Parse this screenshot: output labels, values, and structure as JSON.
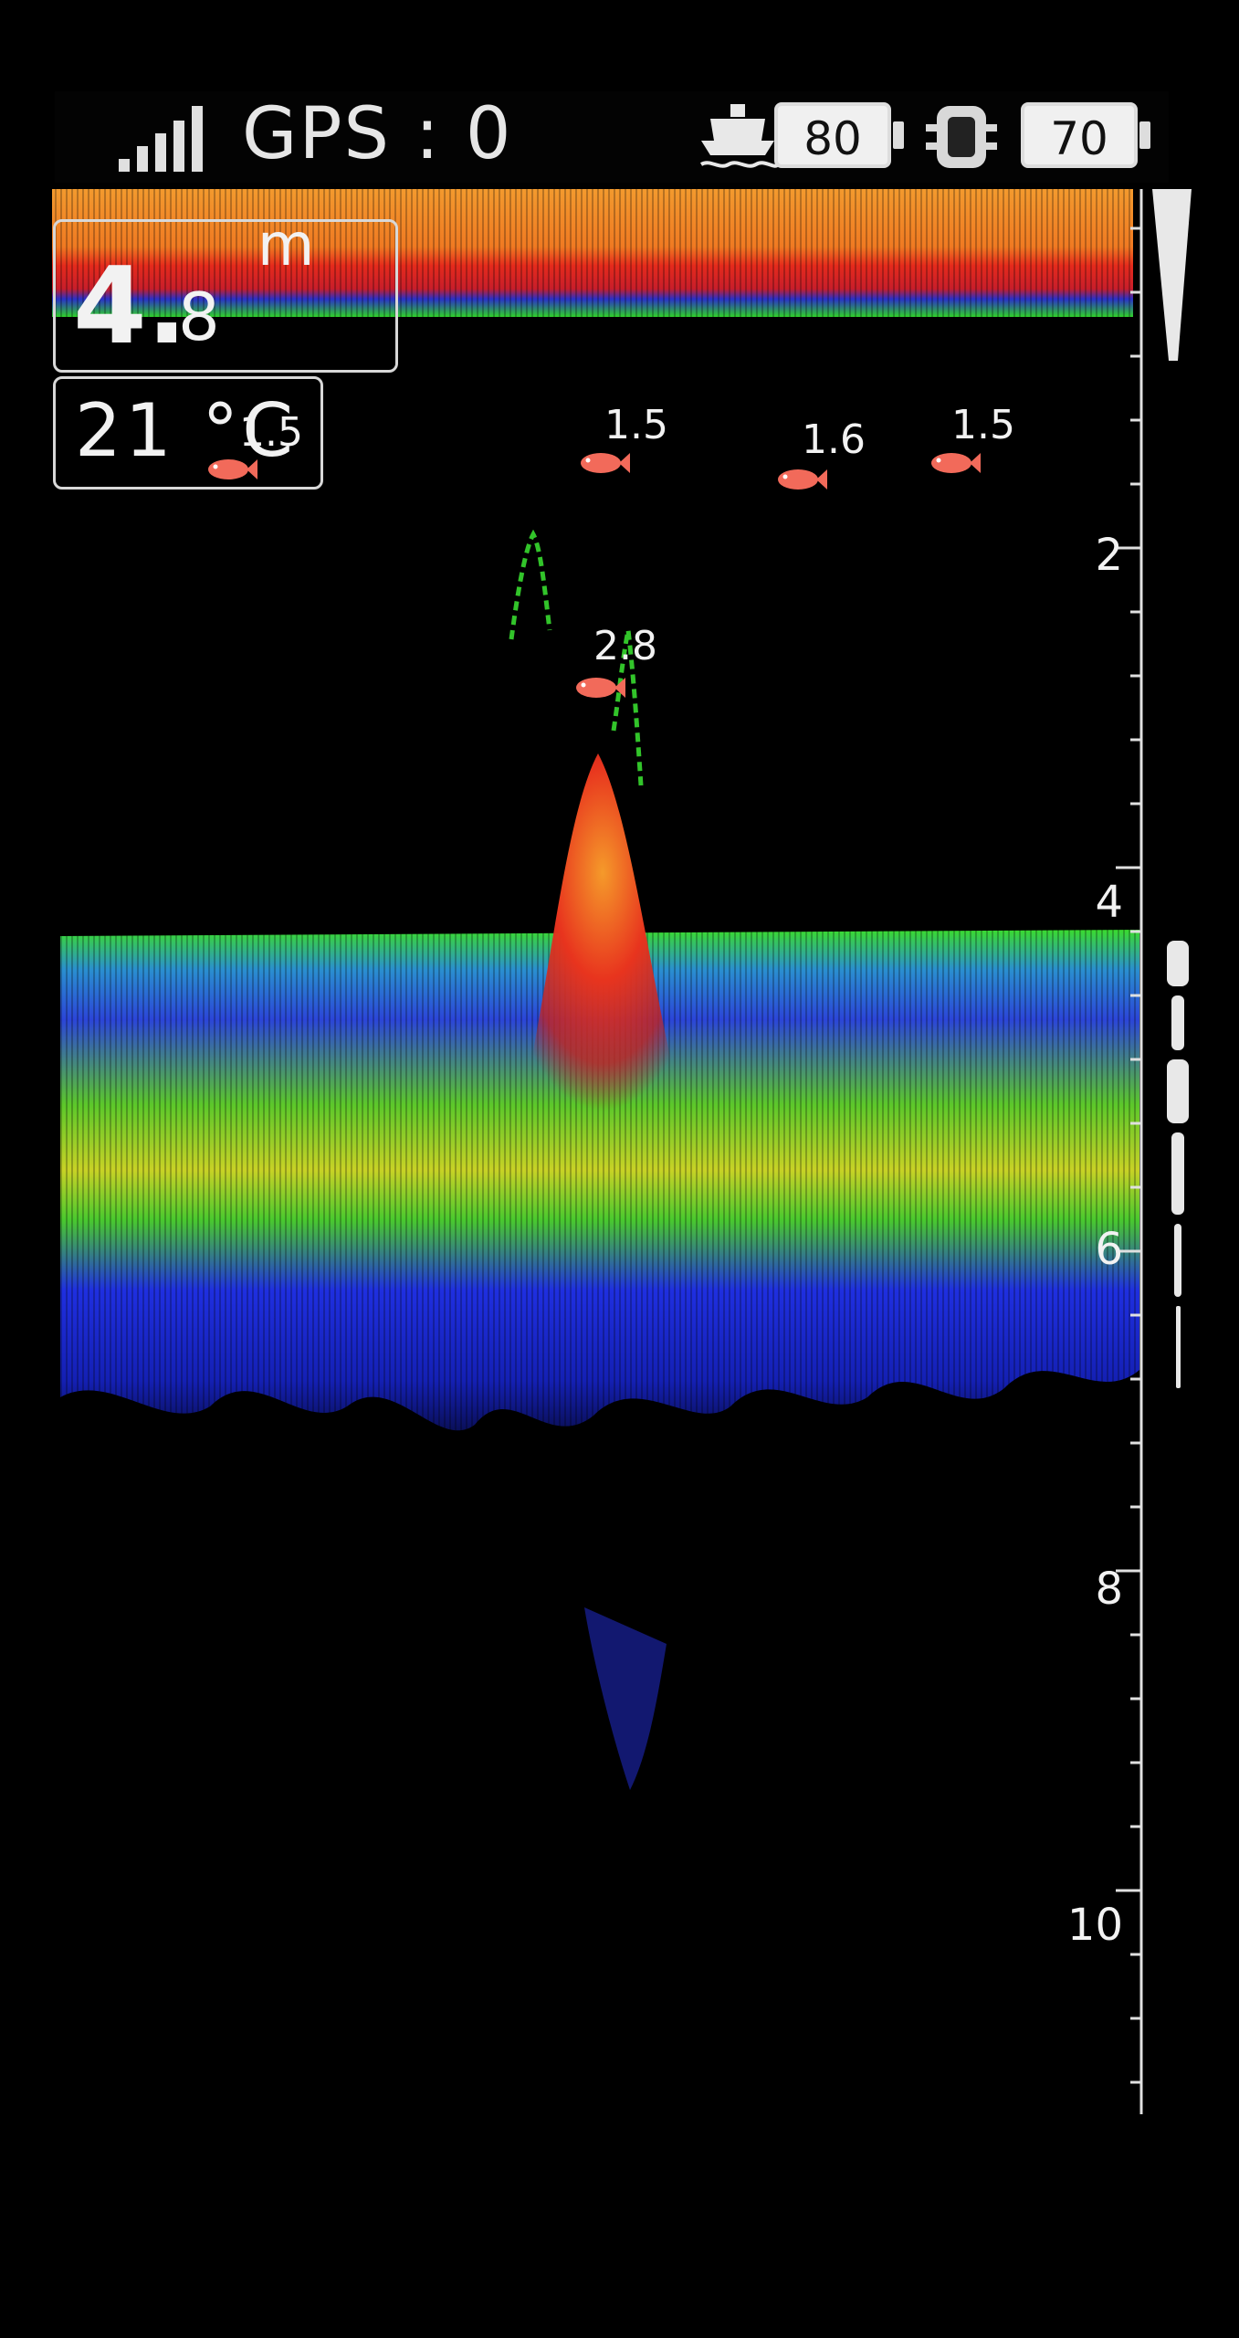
{
  "status_bar": {
    "signal_icon": "signal-bars-icon",
    "gps_label": "GPS : 0",
    "boat_icon": "boat-icon",
    "boat_battery": "80",
    "device_icon": "sonar-device-icon",
    "device_battery": "70"
  },
  "readout": {
    "depth_whole": "4.",
    "depth_decimal": "8",
    "depth_unit": "m",
    "temperature": "21 °C"
  },
  "depth_scale": {
    "labels": [
      "2",
      "4",
      "6",
      "8",
      "10"
    ]
  },
  "fish_marks": [
    {
      "depth": "1.5"
    },
    {
      "depth": "1.5"
    },
    {
      "depth": "1.6"
    },
    {
      "depth": "1.5"
    },
    {
      "depth": "2.8"
    }
  ],
  "colors": {
    "surface_orange": "#f08a2a",
    "surface_red": "#e8261e",
    "echo_blue": "#1a2bd6",
    "echo_green": "#35d62a",
    "echo_yellow": "#d8d61e",
    "fish_icon": "#f26a5a",
    "background": "#000000"
  }
}
